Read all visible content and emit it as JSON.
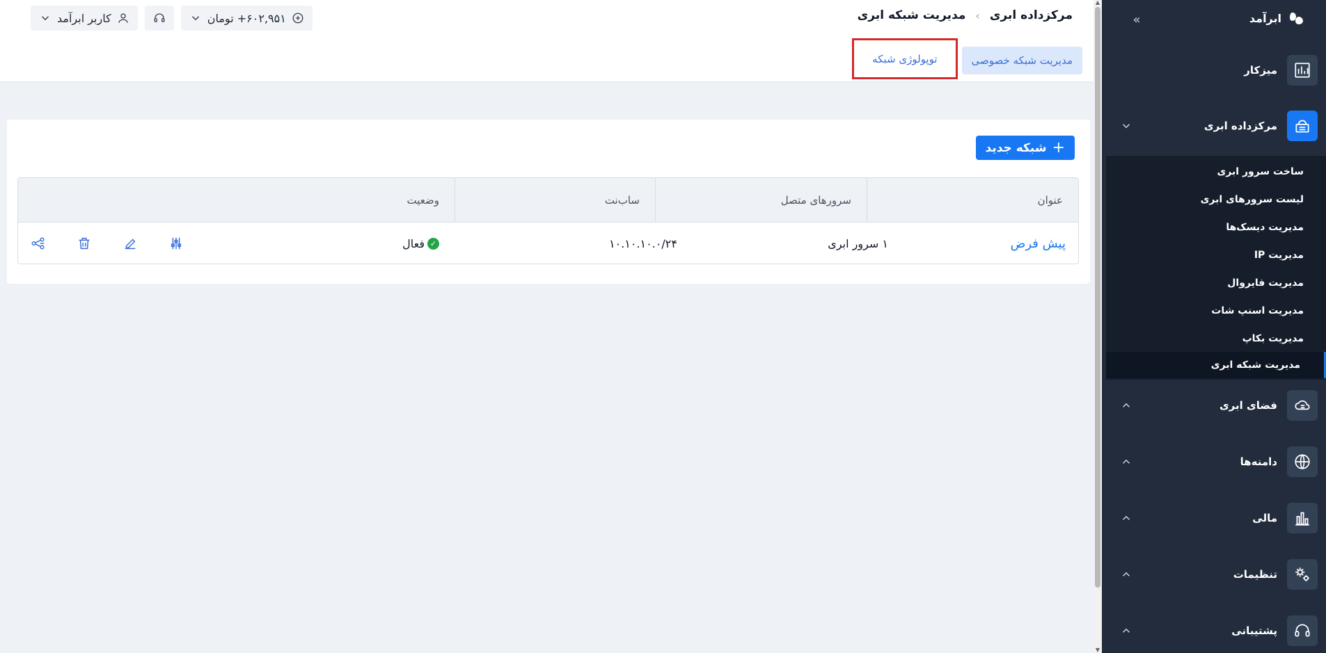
{
  "header": {
    "breadcrumb": [
      "مرکزداده ابری",
      "مدیریت شبکه ابری"
    ],
    "tabs": [
      {
        "label": "مدیریت شبکه خصوصی",
        "active": true
      },
      {
        "label": "توپولوژی شبکه",
        "active": false,
        "highlighted": true
      }
    ],
    "balance": "۶۰۲,۹۵۱+ تومان",
    "user": "کاربر ابرآمد"
  },
  "sidebar": {
    "brand": "ابرآمد",
    "items": [
      {
        "label": "میزکار",
        "icon": "dashboard-chart-icon"
      },
      {
        "label": "مرکزداده ابری",
        "icon": "cloud-datacenter-icon",
        "active": true,
        "expanded": true
      },
      {
        "label": "فضای ابری",
        "icon": "cloud-storage-icon"
      },
      {
        "label": "دامنه‌ها",
        "icon": "globe-icon"
      },
      {
        "label": "مالی",
        "icon": "finance-chart-icon"
      },
      {
        "label": "تنظیمات",
        "icon": "gear-icon"
      },
      {
        "label": "پشتیبانی",
        "icon": "headset-icon"
      }
    ],
    "submenu": [
      "ساخت سرور ابری",
      "لیست سرورهای ابری",
      "مدیریت دیسک‌ها",
      "مدیریت IP",
      "مدیریت فایروال",
      "مدیریت اسنپ شات",
      "مدیریت بکاپ",
      "مدیریت شبکه ابری"
    ],
    "active_submenu": "مدیریت شبکه ابری"
  },
  "main": {
    "new_button": "شبکه جدید",
    "columns": [
      "عنوان",
      "سرورهای متصل",
      "ساب‌نت",
      "وضعیت"
    ],
    "rows": [
      {
        "title": "پیش فرض",
        "servers": "۱ سرور ابری",
        "subnet": "۱۰.۱۰.۱۰.۰/۲۴",
        "status": "فعال",
        "status_color": "#22a447"
      }
    ]
  }
}
